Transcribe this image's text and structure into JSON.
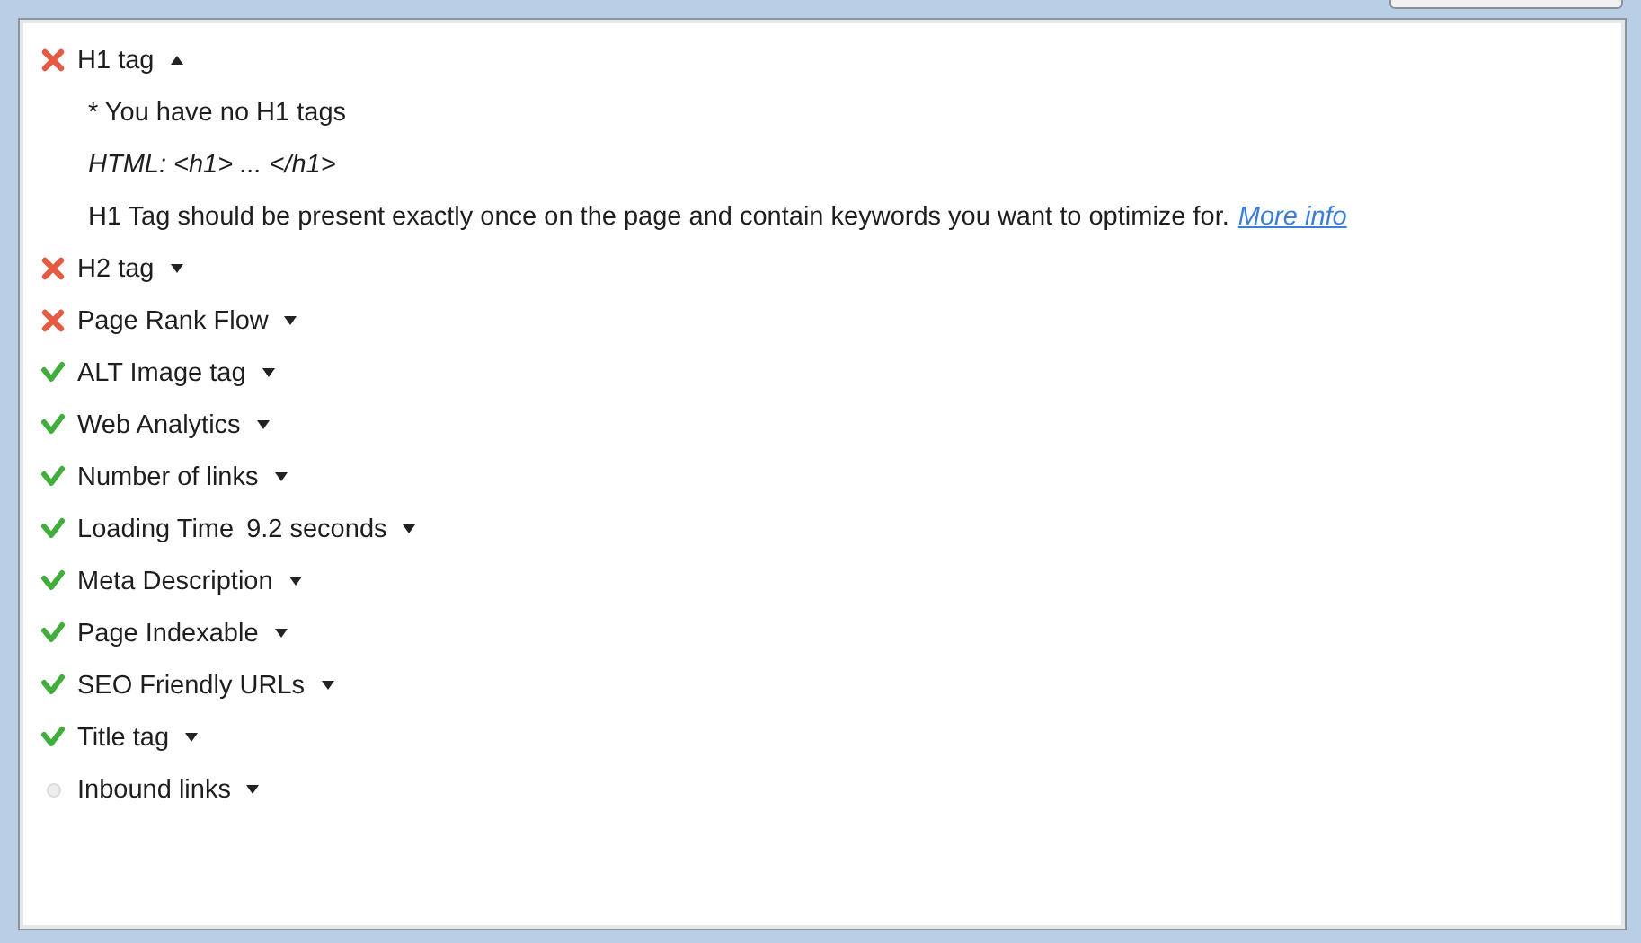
{
  "checks": [
    {
      "label": "H1 tag",
      "kind": "fail",
      "expanded": true,
      "details": [
        {
          "kind": "note",
          "text": "* You have no H1 tags"
        },
        {
          "kind": "code",
          "text": "HTML: <h1> ... </h1>"
        },
        {
          "kind": "info",
          "text": "H1 Tag should be present exactly once on the page and contain keywords you want to optimize for.",
          "link": "More info"
        }
      ]
    },
    {
      "label": "H2 tag",
      "kind": "fail",
      "expanded": false
    },
    {
      "label": "Page Rank Flow",
      "kind": "fail",
      "expanded": false
    },
    {
      "label": "ALT Image tag",
      "kind": "pass",
      "expanded": false
    },
    {
      "label": "Web Analytics",
      "kind": "pass",
      "expanded": false
    },
    {
      "label": "Number of links",
      "kind": "pass",
      "expanded": false
    },
    {
      "label": "Loading Time",
      "value": "9.2 seconds",
      "kind": "pass",
      "expanded": false
    },
    {
      "label": "Meta Description",
      "kind": "pass",
      "expanded": false
    },
    {
      "label": "Page Indexable",
      "kind": "pass",
      "expanded": false
    },
    {
      "label": "SEO Friendly URLs",
      "kind": "pass",
      "expanded": false
    },
    {
      "label": "Title tag",
      "kind": "pass",
      "expanded": false
    },
    {
      "label": "Inbound links",
      "kind": "none",
      "expanded": false
    }
  ]
}
